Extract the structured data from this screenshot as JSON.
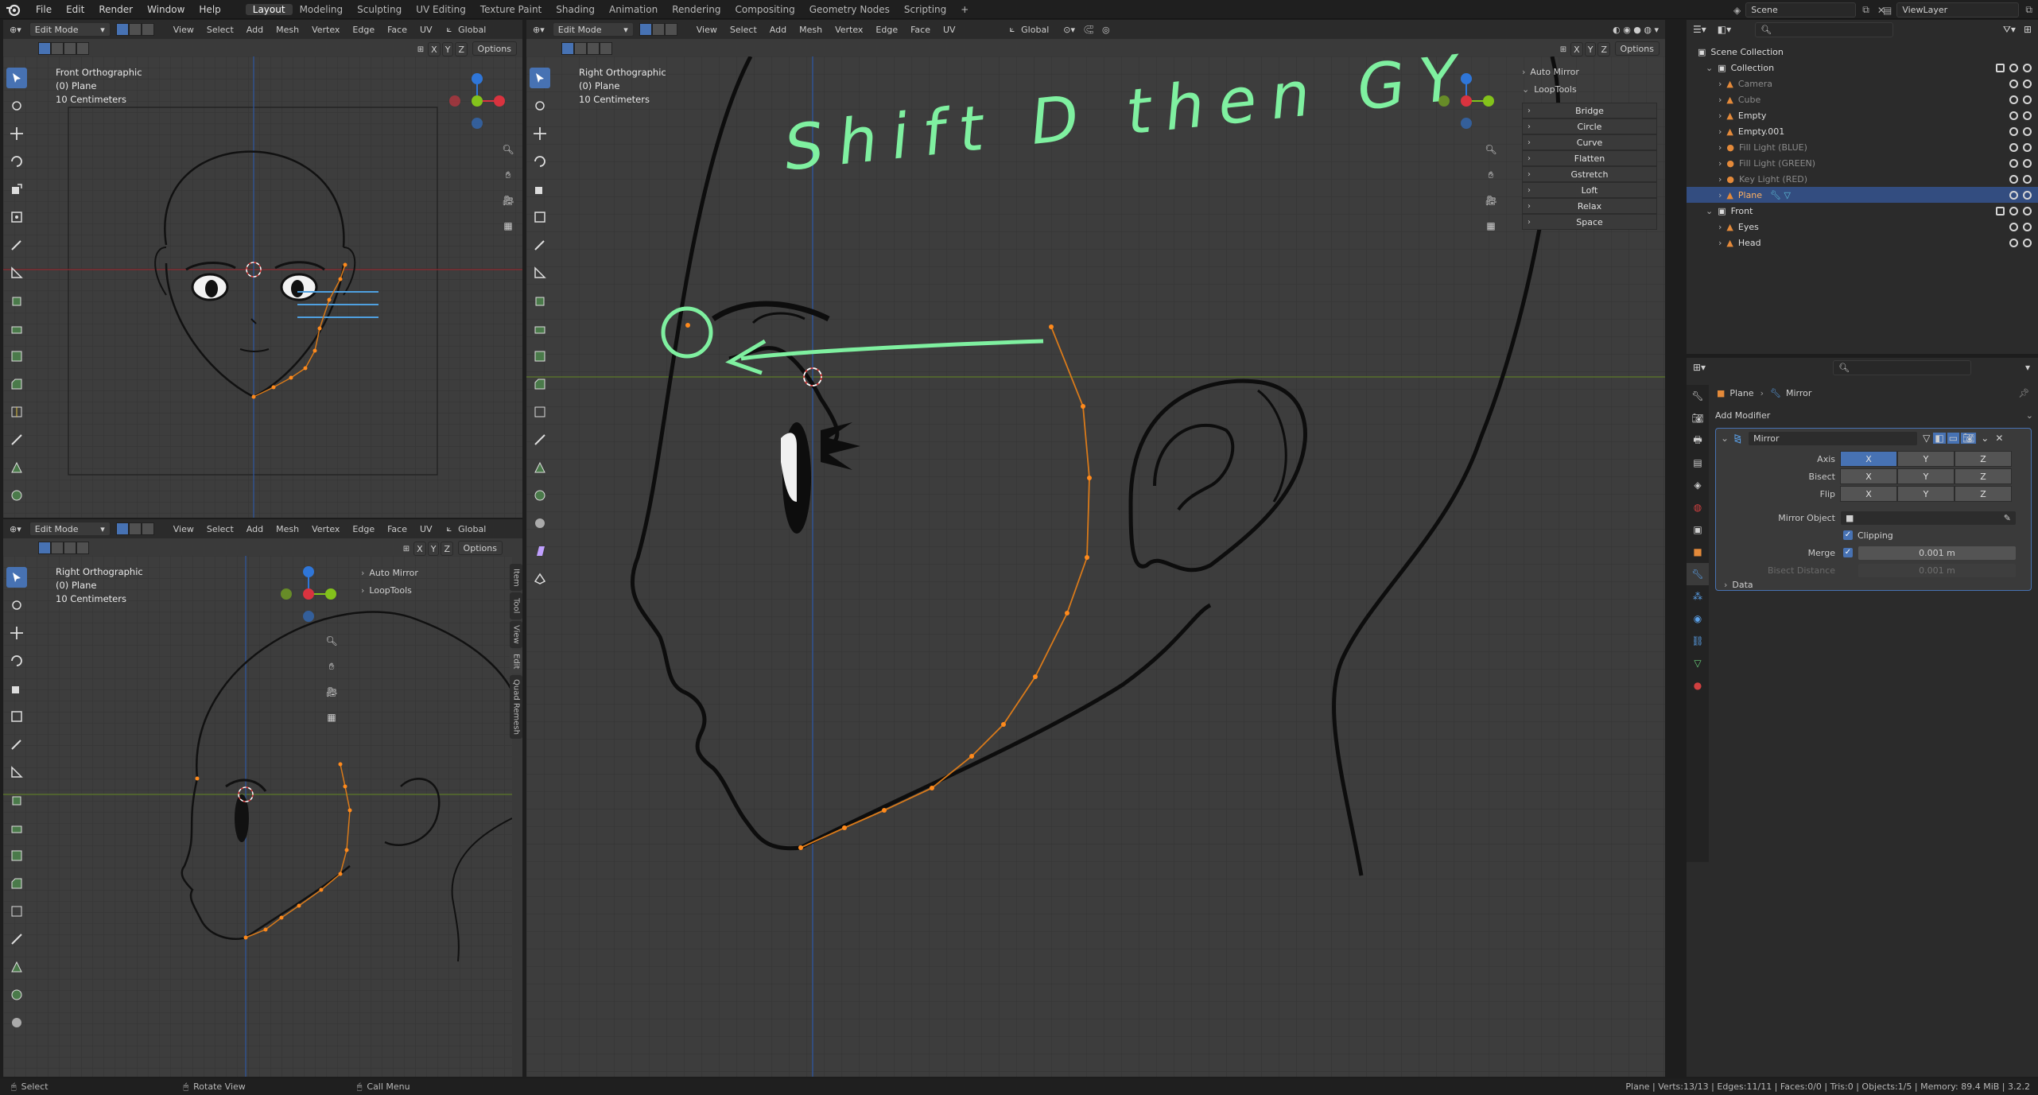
{
  "topbar": {
    "menu": [
      "File",
      "Edit",
      "Render",
      "Window",
      "Help"
    ],
    "workspaces": [
      "Layout",
      "Modeling",
      "Sculpting",
      "UV Editing",
      "Texture Paint",
      "Shading",
      "Animation",
      "Rendering",
      "Compositing",
      "Geometry Nodes",
      "Scripting",
      "+"
    ],
    "active_workspace": "Layout",
    "scene": "Scene",
    "view_layer": "ViewLayer"
  },
  "viewport_header": {
    "mode": "Edit Mode",
    "menus": [
      "View",
      "Select",
      "Add",
      "Mesh",
      "Vertex",
      "Edge",
      "Face",
      "UV"
    ],
    "orientation": "Global",
    "options": "Options",
    "axes": [
      "X",
      "Y",
      "Z"
    ]
  },
  "vp_front": {
    "lines": [
      "Front Orthographic",
      "(0) Plane",
      "10 Centimeters"
    ]
  },
  "vp_right_small": {
    "lines": [
      "Right Orthographic",
      "(0) Plane",
      "10 Centimeters"
    ],
    "panels": [
      "Auto Mirror",
      "LoopTools"
    ]
  },
  "vp_main": {
    "lines": [
      "Right Orthographic",
      "(0) Plane",
      "10 Centimeters"
    ],
    "auto_mirror": "Auto Mirror",
    "looptools": "LoopTools",
    "looptools_buttons": [
      "Bridge",
      "Circle",
      "Curve",
      "Flatten",
      "Gstretch",
      "Loft",
      "Relax",
      "Space"
    ],
    "annotation": "Shift D then GY"
  },
  "side_tabs": [
    "Item",
    "Tool",
    "View",
    "Edit",
    "Quad Remesh"
  ],
  "outliner": {
    "root": "Scene Collection",
    "rows": [
      {
        "label": "Collection",
        "indent": 1
      },
      {
        "label": "Camera",
        "indent": 2,
        "dim": true
      },
      {
        "label": "Cube",
        "indent": 2,
        "dim": true
      },
      {
        "label": "Empty",
        "indent": 2
      },
      {
        "label": "Empty.001",
        "indent": 2
      },
      {
        "label": "Fill Light (BLUE)",
        "indent": 2,
        "dim": true
      },
      {
        "label": "Fill Light (GREEN)",
        "indent": 2,
        "dim": true
      },
      {
        "label": "Key Light (RED)",
        "indent": 2,
        "dim": true
      },
      {
        "label": "Plane",
        "indent": 2,
        "selected": true
      },
      {
        "label": "Front",
        "indent": 1
      },
      {
        "label": "Eyes",
        "indent": 2
      },
      {
        "label": "Head",
        "indent": 2
      }
    ]
  },
  "properties": {
    "breadcrumb_object": "Plane",
    "breadcrumb_modifier": "Mirror",
    "add_modifier": "Add Modifier",
    "modifier_name": "Mirror",
    "axis_label": "Axis",
    "bisect_label": "Bisect",
    "flip_label": "Flip",
    "axes": [
      "X",
      "Y",
      "Z"
    ],
    "mirror_object_label": "Mirror Object",
    "clipping_label": "Clipping",
    "merge_label": "Merge",
    "merge_value": "0.001 m",
    "bisect_distance_label": "Bisect Distance",
    "bisect_distance_value": "0.001 m",
    "data_label": "Data"
  },
  "statusbar": {
    "select": "Select",
    "rotate": "Rotate View",
    "call_menu": "Call Menu",
    "stats": "Plane | Verts:13/13 | Edges:11/11 | Faces:0/0 | Tris:0 | Objects:1/5 | Memory: 89.4 MiB | 3.2.2"
  },
  "colors": {
    "accent": "#4772b3",
    "vertex": "#ff8a1c",
    "edge": "#d97a1a",
    "annotation": "#7ff0a0",
    "x_axis": "#d9333f",
    "y_axis": "#83c21b",
    "z_axis": "#2f76d8"
  }
}
